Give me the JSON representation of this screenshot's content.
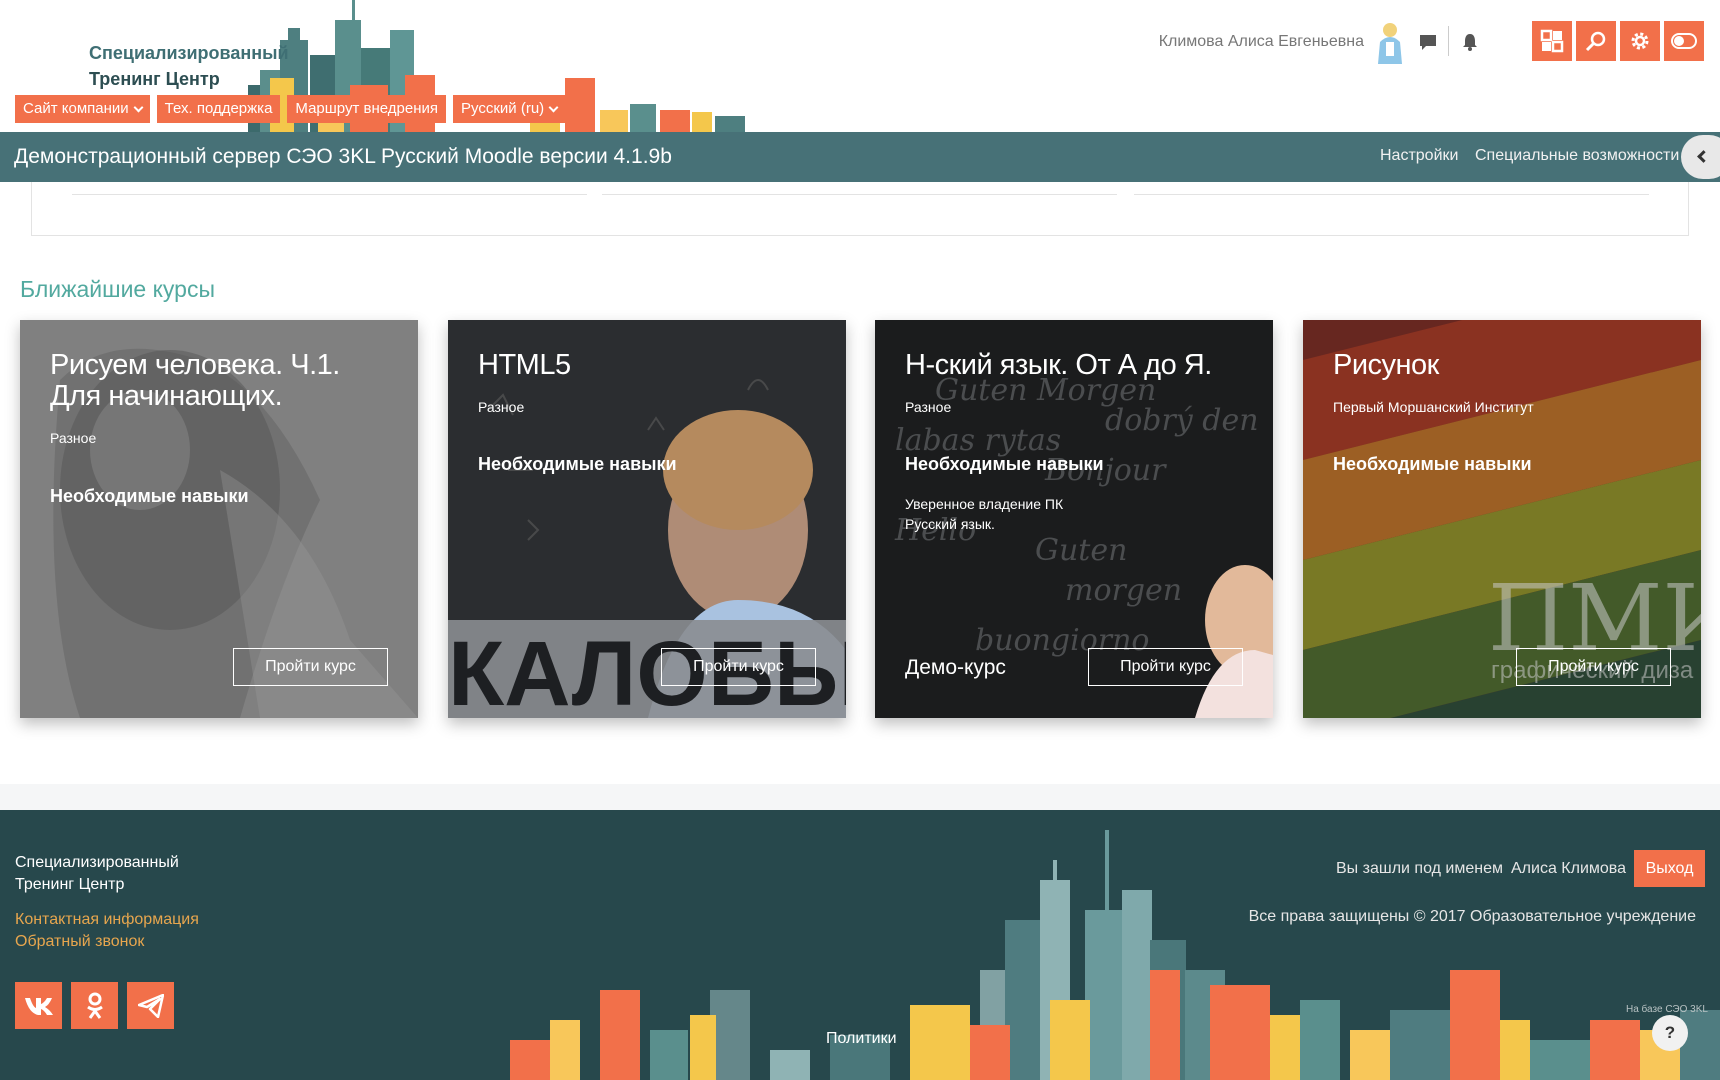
{
  "brand": {
    "line1": "Специализированный",
    "line2": "Тренинг Центр"
  },
  "topnav": [
    {
      "label": "Сайт компании",
      "dropdown": true
    },
    {
      "label": "Тех. поддержка",
      "dropdown": false
    },
    {
      "label": "Маршрут внедрения",
      "dropdown": false
    },
    {
      "label": "Русский (ru)",
      "dropdown": true
    }
  ],
  "user": {
    "name": "Климова Алиса Евгеньевна"
  },
  "header_icons": [
    "chat-icon",
    "bell-icon"
  ],
  "tool_buttons": [
    "grid-icon",
    "search-icon",
    "gear-icon",
    "toggle-icon"
  ],
  "sitebar": {
    "title": "Демонстрационный сервер СЭО 3KL Русский Moodle версии 4.1.9b",
    "settings": "Настройки",
    "accessibility": "Специальные возможности"
  },
  "section_title": "Ближайшие курсы",
  "courses": [
    {
      "title": "Рисуем человека. Ч.1. Для начинающих.",
      "category": "Разное",
      "skills": "Необходимые навыки",
      "requirements": [],
      "demo": "",
      "button": "Пройти курс"
    },
    {
      "title": "HTML5",
      "category": "Разное",
      "skills": "Необходимые навыки",
      "requirements": [],
      "demo": "",
      "button": "Пройти курс",
      "bg_text": "КАЛОБЫ"
    },
    {
      "title": "Н-ский язык. От А до Я.",
      "category": "Разное",
      "skills": "Необходимые навыки",
      "requirements": [
        "Уверенное владение ПК",
        "Русский язык."
      ],
      "demo": "Демо-курс",
      "button": "Пройти курс"
    },
    {
      "title": "Рисунок",
      "category": "Первый Моршанский Институт",
      "skills": "Необходимые навыки",
      "requirements": [],
      "demo": "",
      "button": "Пройти курс",
      "bg_text": "ПМИ",
      "bg_text2": "графический диза"
    }
  ],
  "footer": {
    "brand_line1": "Специализированный",
    "brand_line2": "Тренинг Центр",
    "contact": "Контактная информация",
    "callback": "Обратный звонок",
    "social": [
      "vk-icon",
      "odnoklassniki-icon",
      "telegram-icon"
    ],
    "policy": "Политики",
    "logged_in_as": "Вы зашли под именем",
    "user_short": "Алиса Климова",
    "logout": "Выход",
    "copyright": "Все права защищены © 2017 Образовательное учреждение",
    "powered": "На базе СЭО 3KL",
    "help": "?"
  },
  "colors": {
    "accent": "#f2704a",
    "teal": "#477177",
    "footer": "#27484c",
    "link_gold": "#e7a64e",
    "section_title": "#52a99f"
  }
}
